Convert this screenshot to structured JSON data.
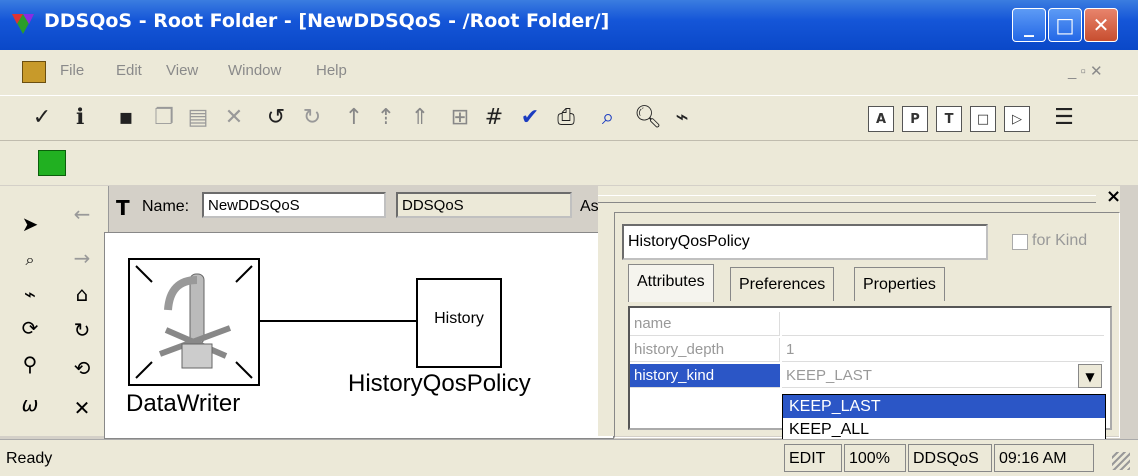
{
  "window": {
    "title": "DDSQoS - Root Folder - [NewDDSQoS - /Root Folder/]",
    "minimize_glyph": "_",
    "maximize_glyph": "□",
    "close_glyph": "✕"
  },
  "menu": {
    "items": [
      "File",
      "Edit",
      "View",
      "Window",
      "Help"
    ],
    "mdi_controls": "_ ▫ ✕"
  },
  "toolbar": {
    "icons": [
      "check-icon",
      "info-icon",
      "save-icon",
      "copy-icon",
      "paste-icon",
      "delete-icon",
      "undo-icon",
      "redo-icon",
      "up-icon",
      "up-plus-icon",
      "up-dot-icon",
      "layout-icon",
      "grid-icon",
      "validate-icon",
      "print-icon",
      "find-icon",
      "zoom-icon",
      "connect-icon"
    ],
    "view_buttons": [
      "A",
      "P",
      "T",
      "□",
      "▷"
    ]
  },
  "editor": {
    "name_label": "Name:",
    "name_value": "NewDDSQoS",
    "kind_value": "DDSQoS",
    "aspect_label": "As",
    "nodes": {
      "datawriter_label": "DataWriter",
      "history_box_label": "History",
      "history_policy_label": "HistoryQosPolicy"
    }
  },
  "panel": {
    "object_name": "HistoryQosPolicy",
    "for_kind_label": "for Kind",
    "tabs": [
      "Attributes",
      "Preferences",
      "Properties"
    ],
    "attributes": [
      {
        "name": "name",
        "value": ""
      },
      {
        "name": "history_depth",
        "value": "1"
      },
      {
        "name": "history_kind",
        "value": "KEEP_LAST"
      }
    ],
    "dropdown_options": [
      "KEEP_LAST",
      "KEEP_ALL"
    ],
    "close_glyph": "×"
  },
  "status": {
    "text": "Ready",
    "mode": "EDIT",
    "zoom": "100%",
    "paradigm": "DDSQoS",
    "time": "09:16 AM"
  }
}
